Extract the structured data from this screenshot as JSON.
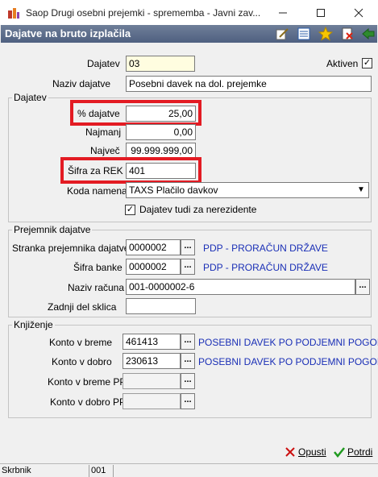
{
  "window": {
    "title": "Saop   Drugi osebni prejemki  - sprememba - Javni zav...",
    "subtitle": "Dajatve na bruto izplačila"
  },
  "form": {
    "dajatev_label": "Dajatev",
    "dajatev_value": "03",
    "aktiven_label": "Aktiven",
    "aktiven_checked": true,
    "naziv_label": "Naziv dajatve",
    "naziv_value": "Posebni davek na dol. prejemke"
  },
  "group_dajatev": {
    "legend": "Dajatev",
    "pct_label": "% dajatve",
    "pct_value": "25,00",
    "najmanj_label": "Najmanj",
    "najmanj_value": "0,00",
    "najvec_label": "Največ",
    "najvec_value": "99.999.999,00",
    "sifra_rek_label": "Šifra za REK",
    "sifra_rek_value": "401",
    "koda_namena_label": "Koda namena",
    "koda_namena_value": "TAXS Plačilo davkov",
    "nerezidente_label": "Dajatev tudi za nerezidente",
    "nerezidente_checked": true
  },
  "group_prejemnik": {
    "legend": "Prejemnik dajatve",
    "stranka_label": "Stranka prejemnika dajatve",
    "stranka_value": "0000002",
    "stranka_name": "PDP - PRORAČUN DRŽAVE",
    "banka_label": "Šifra banke",
    "banka_value": "0000002",
    "banka_name": "PDP - PRORAČUN DRŽAVE",
    "racun_label": "Naziv računa",
    "racun_value": "001-0000002-6",
    "sklic_label": "Zadnji del sklica",
    "sklic_value": ""
  },
  "group_knjizenje": {
    "legend": "Knjiženje",
    "breme_label": "Konto v breme",
    "breme_value": "461413",
    "breme_name": "POSEBNI DAVEK PO PODJEMNI POGODBI",
    "dobro_label": "Konto v dobro",
    "dobro_value": "230613",
    "dobro_name": "POSEBNI DAVEK PO PODJEMNI POGODBI",
    "breme_pp_label": "Konto v breme PP",
    "breme_pp_value": "",
    "dobro_pp_label": "Konto v dobro PP",
    "dobro_pp_value": ""
  },
  "buttons": {
    "opusti": "Opusti",
    "potrdi": "Potrdi",
    "dots": "..."
  },
  "status": {
    "user": "Skrbnik",
    "code": "001"
  },
  "colors": {
    "highlight": "#e31b23",
    "link_blue": "#1a2fb6",
    "header_bar": "#5a6a88"
  }
}
